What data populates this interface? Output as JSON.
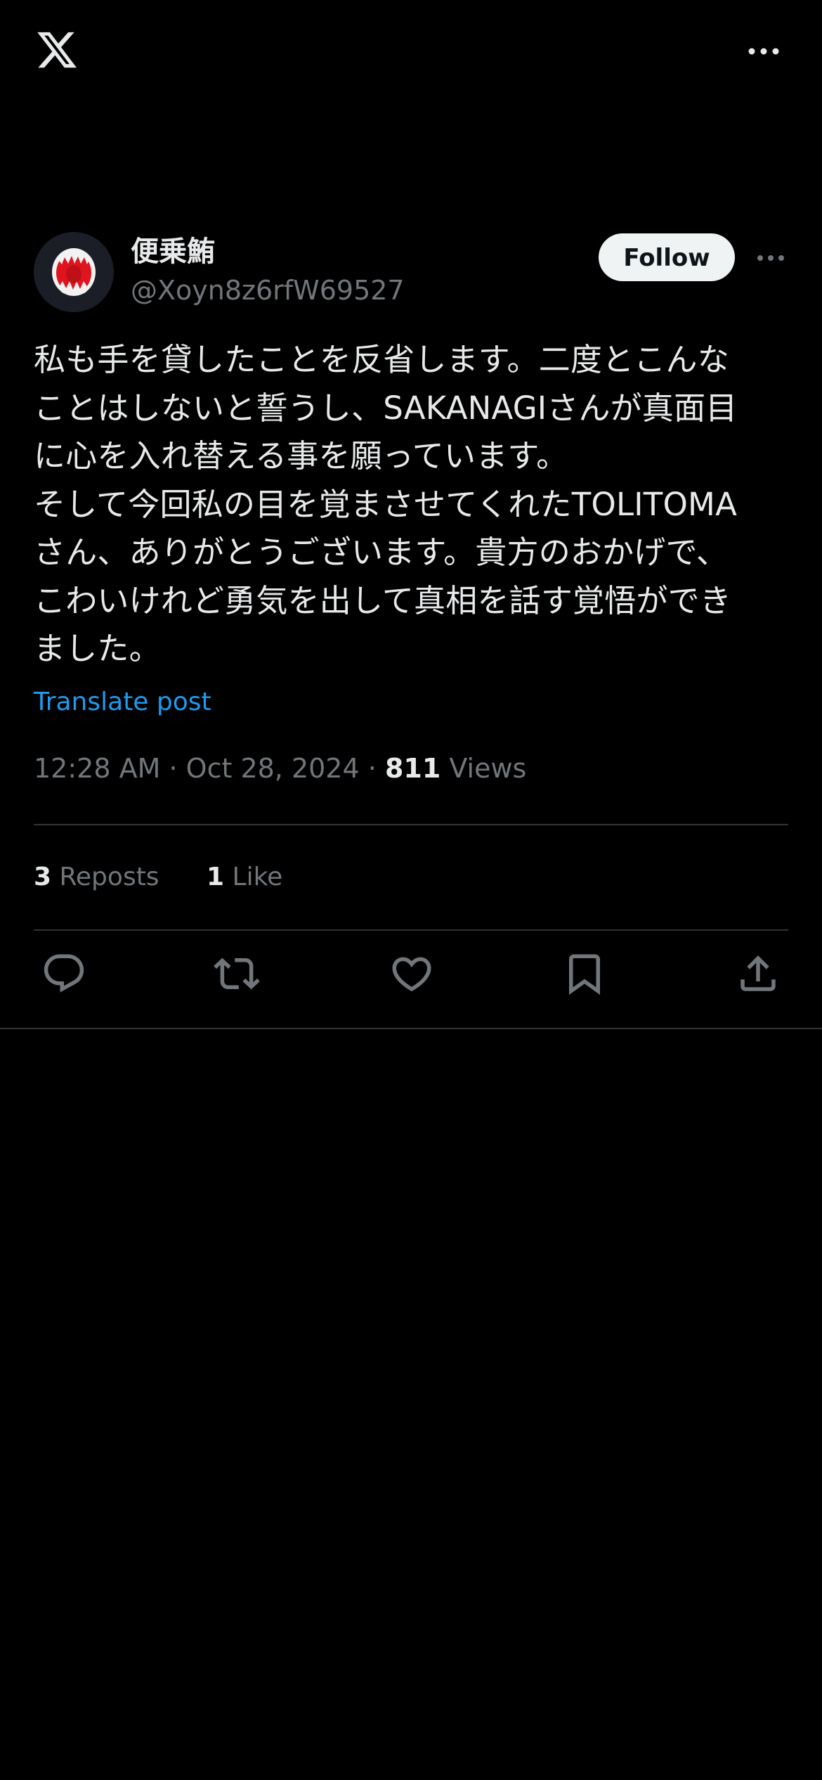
{
  "top_bar": {
    "logo_icon": "x-logo-icon",
    "more_icon": "more-horizontal-icon"
  },
  "post": {
    "author": {
      "name": "便乗鮪",
      "handle": "@Xoyn8z6rfW69527",
      "avatar_icon": "red-open-mouth-avatar"
    },
    "follow_label": "Follow",
    "more_icon": "more-horizontal-icon",
    "text_lines": [
      "私も手を貸したことを反省します。二度とこんな",
      "ことはしないと誓うし、SAKANAGIさんが真面目",
      "に心を入れ替える事を願っています。",
      "そして今回私の目を覚まさせてくれたTOLITOMA",
      "さん、ありがとうございます。貴方のおかげで、",
      "こわいけれど勇気を出して真相を話す覚悟ができ",
      "ました。"
    ],
    "translate_label": "Translate post",
    "time": "12:28 AM",
    "separator": "·",
    "date": "Oct 28, 2024",
    "views_count": "811",
    "views_label": "Views",
    "stats": {
      "reposts_count": "3",
      "reposts_label": "Reposts",
      "likes_count": "1",
      "likes_label": "Like"
    },
    "actions": [
      {
        "name": "reply",
        "icon": "reply-icon"
      },
      {
        "name": "repost",
        "icon": "repost-icon"
      },
      {
        "name": "like",
        "icon": "heart-icon"
      },
      {
        "name": "bookmark",
        "icon": "bookmark-icon"
      },
      {
        "name": "share",
        "icon": "share-icon"
      }
    ]
  },
  "colors": {
    "background": "#000000",
    "text_primary": "#e7e9ea",
    "text_secondary": "#71767b",
    "link": "#1d9bf0",
    "divider": "#2f3336",
    "follow_bg": "#eff3f4",
    "avatar_red": "#e0141f"
  }
}
